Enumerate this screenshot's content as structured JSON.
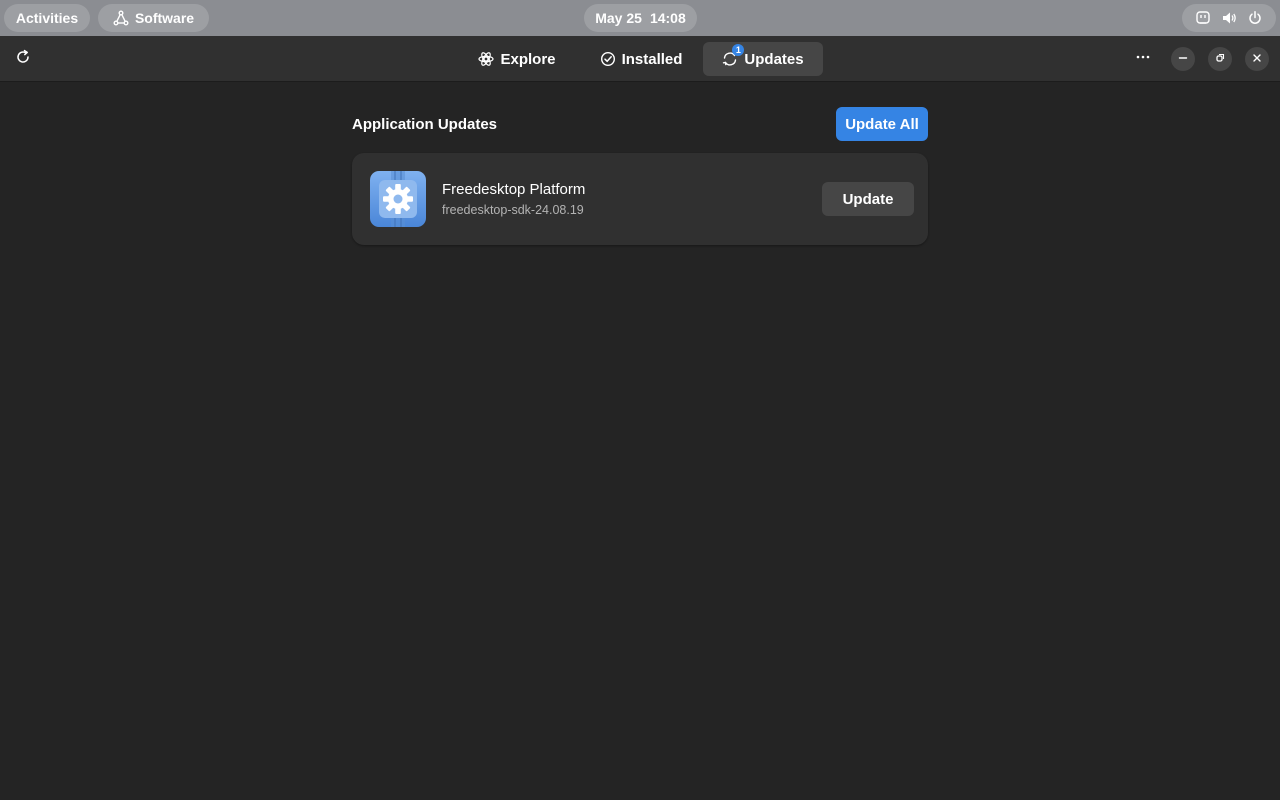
{
  "topbar": {
    "activities_label": "Activities",
    "app_label": "Software",
    "app_icon": "software-icon",
    "clock_date": "May 25",
    "clock_time": "14:08",
    "system_icons": [
      "accessibility-icon",
      "volume-icon",
      "power-icon"
    ]
  },
  "header": {
    "refresh_icon": "refresh-icon",
    "tabs": [
      {
        "label": "Explore",
        "icon": "explore-icon",
        "active": false
      },
      {
        "label": "Installed",
        "icon": "installed-check-icon",
        "active": false
      },
      {
        "label": "Updates",
        "icon": "updates-sync-icon",
        "active": true,
        "badge": "1"
      }
    ],
    "menu_icon": "more-dots-icon",
    "window_controls": [
      "minimize-icon",
      "maximize-icon",
      "close-icon"
    ]
  },
  "content": {
    "section_title": "Application Updates",
    "update_all_label": "Update All",
    "apps": [
      {
        "name": "Freedesktop Platform",
        "subtitle": "freedesktop-sdk-24.08.19",
        "icon": "freedesktop-gear-icon",
        "button_label": "Update"
      }
    ]
  },
  "colors": {
    "accent": "#3584e4",
    "window_bg": "#242424",
    "headerbar_bg": "#303030",
    "card_bg": "#303030",
    "topbar_bg": "#8b8d92"
  }
}
